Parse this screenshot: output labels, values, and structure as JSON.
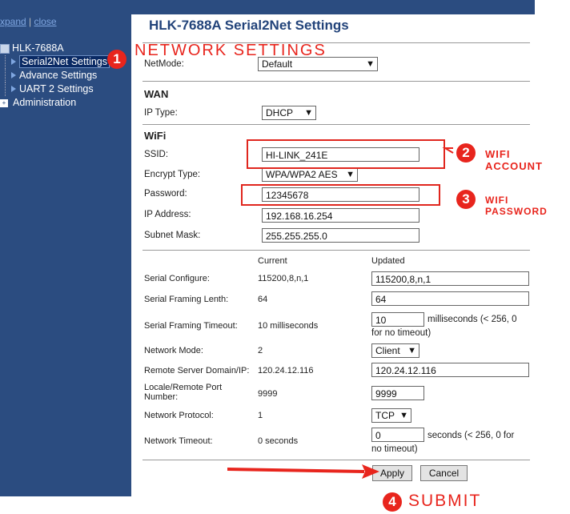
{
  "sidebar": {
    "expand_label": "xpand",
    "separator": "|",
    "close_label": "close",
    "device": "HLK-7688A",
    "items": [
      {
        "label": "Serial2Net Settings"
      },
      {
        "label": "Advance Settings"
      },
      {
        "label": "UART 2 Settings"
      }
    ],
    "administration": "Administration"
  },
  "page": {
    "title": "HLK-7688A Serial2Net Settings"
  },
  "netmode": {
    "label": "NetMode:",
    "value": "Default"
  },
  "wan": {
    "heading": "WAN",
    "ip_type_label": "IP Type:",
    "ip_type_value": "DHCP"
  },
  "wifi": {
    "heading": "WiFi",
    "ssid_label": "SSID:",
    "ssid_value": "HI-LINK_241E",
    "encrypt_label": "Encrypt Type:",
    "encrypt_value": "WPA/WPA2 AES",
    "password_label": "Password:",
    "password_value": "12345678",
    "ip_label": "IP Address:",
    "ip_value": "192.168.16.254",
    "mask_label": "Subnet Mask:",
    "mask_value": "255.255.255.0"
  },
  "serial": {
    "col_current": "Current",
    "col_updated": "Updated",
    "rows": [
      {
        "label": "Serial Configure:",
        "current": "115200,8,n,1",
        "updated": "115200,8,n,1"
      },
      {
        "label": "Serial Framing Lenth:",
        "current": "64",
        "updated": "64"
      },
      {
        "label": "Serial Framing Timeout:",
        "current": "10 milliseconds",
        "updated": "10",
        "note_a": "milliseconds (< 256, 0",
        "note_b": "for no timeout)"
      },
      {
        "label": "Network Mode:",
        "current": "2",
        "updated": "Client"
      },
      {
        "label": "Remote Server Domain/IP:",
        "current": "120.24.12.116",
        "updated": "120.24.12.116"
      },
      {
        "label_a": "Locale/Remote Port",
        "label_b": "Number:",
        "current": "9999",
        "updated": "9999"
      },
      {
        "label": "Network Protocol:",
        "current": "1",
        "updated": "TCP"
      },
      {
        "label": "Network Timeout:",
        "current": "0 seconds",
        "updated": "0",
        "note_a": "seconds (< 256, 0 for",
        "note_b": "no timeout)"
      }
    ]
  },
  "buttons": {
    "apply": "Apply",
    "cancel": "Cancel"
  },
  "annotations": {
    "n1": "1",
    "t1": "NETWORK SETTINGS",
    "n2": "2",
    "t2": "WIFI ACCOUNT",
    "n3": "3",
    "t3": "WIFI PASSWORD",
    "n4": "4",
    "t4": "SUBMIT"
  },
  "colors": {
    "sidebar": "#2b4c80",
    "title": "#22437a",
    "annotation": "#e8251d"
  }
}
